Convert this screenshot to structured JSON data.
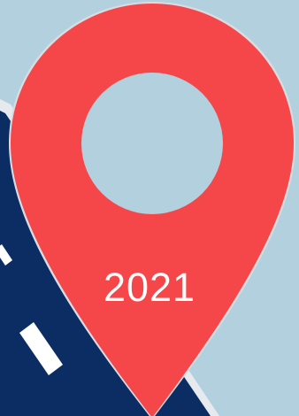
{
  "pin_label": "2021",
  "colors": {
    "sky": "#b3d0df",
    "road": "#0b2d63",
    "road_edge": "#e6e9ee",
    "lane_marking": "#ffffff",
    "pin": "#f5474a",
    "pin_outline": "#d9dde2",
    "pin_hole": "#b3d0df"
  },
  "icons": {
    "pin": "map-pin-icon",
    "road": "road-graphic"
  }
}
